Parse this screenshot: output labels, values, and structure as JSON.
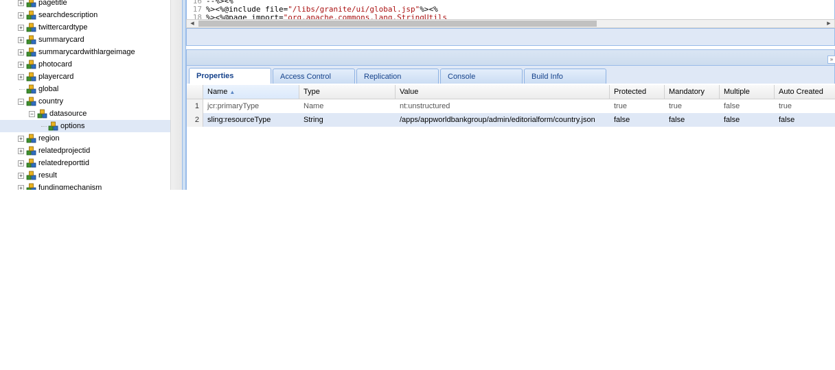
{
  "tree": {
    "items": [
      {
        "label": "pagetitle",
        "expander": "+"
      },
      {
        "label": "searchdescription",
        "expander": "+"
      },
      {
        "label": "twittercardtype",
        "expander": "+"
      },
      {
        "label": "summarycard",
        "expander": "+"
      },
      {
        "label": "summarycardwithlargeimage",
        "expander": "+"
      },
      {
        "label": "photocard",
        "expander": "+"
      },
      {
        "label": "playercard",
        "expander": "+"
      },
      {
        "label": "global",
        "expander": ""
      },
      {
        "label": "country",
        "expander": "−"
      },
      {
        "label": "datasource",
        "expander": "−"
      },
      {
        "label": "options",
        "expander": ""
      },
      {
        "label": "region",
        "expander": "+"
      },
      {
        "label": "relatedprojectid",
        "expander": "+"
      },
      {
        "label": "relatedreporttid",
        "expander": "+"
      },
      {
        "label": "result",
        "expander": "+"
      },
      {
        "label": "fundingmechanism",
        "expander": "+"
      }
    ],
    "selected": "options"
  },
  "editor": {
    "lines": [
      {
        "num": "16",
        "text": "--%><%"
      },
      {
        "num": "17",
        "pre": "%><%@include file=",
        "str": "\"/libs/granite/ui/global.jsp\"",
        "post": "%><%"
      },
      {
        "num": "18",
        "pre": "%><%@page import=",
        "str": "\"org.apache.commons.lang.StringUtils",
        "post": ""
      }
    ]
  },
  "tabs": [
    {
      "label": "Properties",
      "active": true
    },
    {
      "label": "Access Control",
      "active": false
    },
    {
      "label": "Replication",
      "active": false
    },
    {
      "label": "Console",
      "active": false
    },
    {
      "label": "Build Info",
      "active": false
    }
  ],
  "grid": {
    "columns": [
      "Name",
      "Type",
      "Value",
      "Protected",
      "Mandatory",
      "Multiple",
      "Auto Created"
    ],
    "sort_column": "Name",
    "sort_direction": "ascending",
    "rows": [
      {
        "num": "1",
        "name": "jcr:primaryType",
        "type": "Name",
        "value": "nt:unstructured",
        "protected": "true",
        "mandatory": "true",
        "multiple": "false",
        "auto": "true",
        "editable": false
      },
      {
        "num": "2",
        "name": "sling:resourceType",
        "type": "String",
        "value": "/apps/appworldbankgroup/admin/editorialform/country.json",
        "protected": "false",
        "mandatory": "false",
        "multiple": "false",
        "auto": "false",
        "editable": true
      }
    ]
  },
  "colors": {
    "panel_border": "#99bbe8",
    "panel_bg": "#dfe8f6",
    "tab_text": "#15428b",
    "selection": "#dfe8f6"
  },
  "icons": {
    "node": "node-cubes-icon",
    "expand": "plus-square-icon",
    "collapse": "minus-square-icon"
  }
}
